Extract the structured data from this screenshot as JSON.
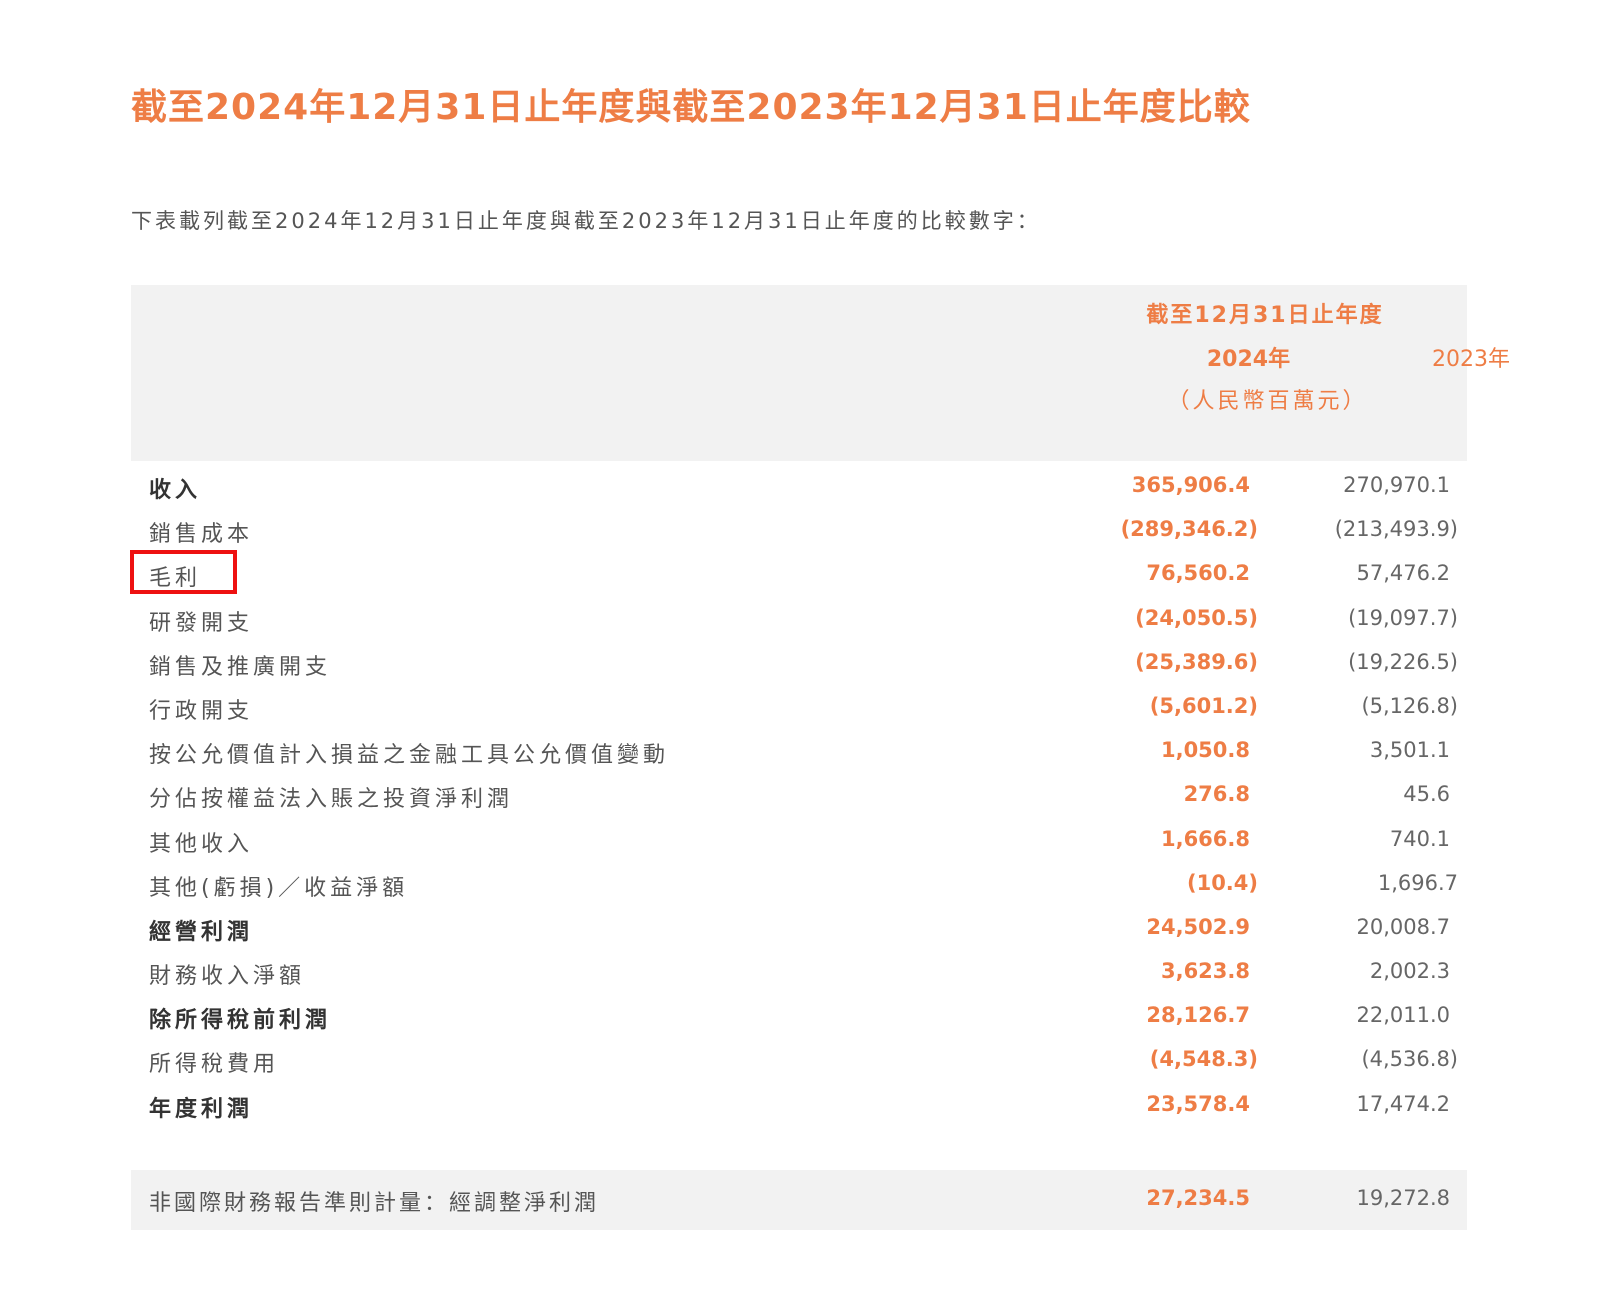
{
  "title": "截至2024年12月31日止年度與截至2023年12月31日止年度比較",
  "intro": "下表載列截至2024年12月31日止年度與截至2023年12月31日止年度的比較數字：",
  "table": {
    "header": {
      "period": "截至12月31日止年度",
      "year_2024": "2024年",
      "year_2023": "2023年",
      "unit": "（人民幣百萬元）"
    },
    "rows": [
      {
        "label": "收入",
        "v2024": "365,906.4",
        "v2023": "270,970.1",
        "bold": true,
        "neg": false
      },
      {
        "label": "銷售成本",
        "v2024": "(289,346.2)",
        "v2023": "(213,493.9)",
        "bold": false,
        "neg": true
      },
      {
        "label": "毛利",
        "v2024": "76,560.2",
        "v2023": "57,476.2",
        "bold": false,
        "neg": false,
        "highlighted": true
      },
      {
        "label": "研發開支",
        "v2024": "(24,050.5)",
        "v2023": "(19,097.7)",
        "bold": false,
        "neg": true
      },
      {
        "label": "銷售及推廣開支",
        "v2024": "(25,389.6)",
        "v2023": "(19,226.5)",
        "bold": false,
        "neg": true
      },
      {
        "label": "行政開支",
        "v2024": "(5,601.2)",
        "v2023": "(5,126.8)",
        "bold": false,
        "neg": true
      },
      {
        "label": "按公允價值計入損益之金融工具公允價值變動",
        "v2024": "1,050.8",
        "v2023": "3,501.1",
        "bold": false,
        "neg": false
      },
      {
        "label": "分佔按權益法入賬之投資淨利潤",
        "v2024": "276.8",
        "v2023": "45.6",
        "bold": false,
        "neg": false
      },
      {
        "label": "其他收入",
        "v2024": "1,666.8",
        "v2023": "740.1",
        "bold": false,
        "neg": false
      },
      {
        "label": "其他(虧損)／收益淨額",
        "v2024": "(10.4)",
        "v2023": "1,696.7",
        "bold": false,
        "neg": true
      },
      {
        "label": "經營利潤",
        "v2024": "24,502.9",
        "v2023": "20,008.7",
        "bold": true,
        "neg": false
      },
      {
        "label": "財務收入淨額",
        "v2024": "3,623.8",
        "v2023": "2,002.3",
        "bold": false,
        "neg": false
      },
      {
        "label": "除所得稅前利潤",
        "v2024": "28,126.7",
        "v2023": "22,011.0",
        "bold": true,
        "neg": false
      },
      {
        "label": "所得稅費用",
        "v2024": "(4,548.3)",
        "v2023": "(4,536.8)",
        "bold": false,
        "neg": true
      },
      {
        "label": "年度利潤",
        "v2024": "23,578.4",
        "v2023": "17,474.2",
        "bold": true,
        "neg": false
      }
    ],
    "footer": {
      "label": "非國際財務報告準則計量：經調整淨利潤",
      "v2024": "27,234.5",
      "v2023": "19,272.8"
    }
  },
  "colors": {
    "accent": "#ee7d45",
    "highlight_border": "#ee1111",
    "header_bg": "#f2f2f2"
  }
}
